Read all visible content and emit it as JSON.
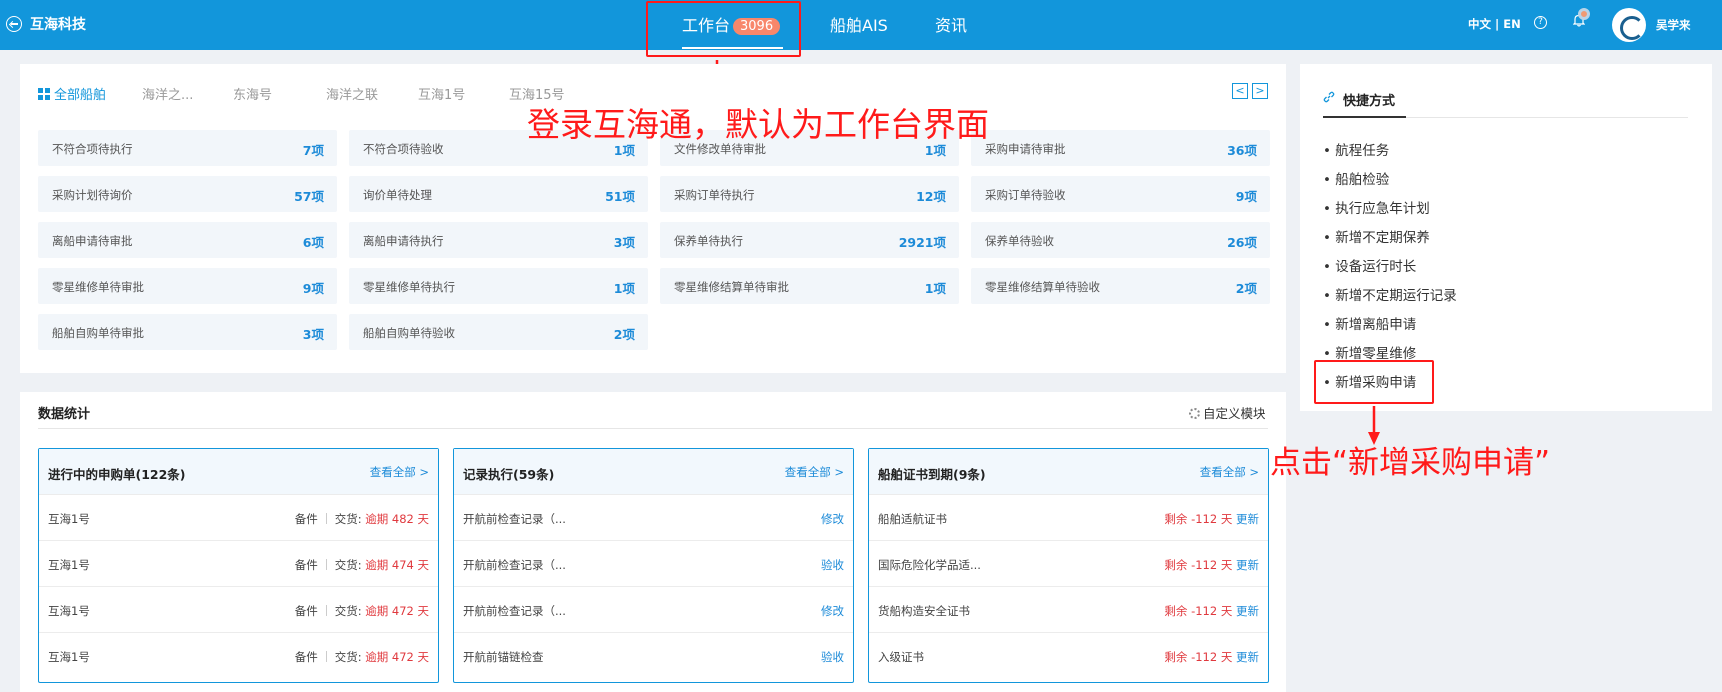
{
  "header": {
    "brand": "互海科技",
    "tabs": [
      {
        "label": "工作台",
        "badge": "3096"
      },
      {
        "label": "船舶AIS"
      },
      {
        "label": "资讯"
      }
    ],
    "language": "中文 | EN",
    "help_glyph": "?",
    "username": "吴学来"
  },
  "ship_tabs": [
    "全部船舶",
    "海洋之...",
    "东海号",
    "海洋之联",
    "互海1号",
    "互海15号"
  ],
  "pager": {
    "prev": "<",
    "next": ">"
  },
  "tasks": [
    {
      "label": "不符合项待执行",
      "value": "7项"
    },
    {
      "label": "不符合项待验收",
      "value": "1项"
    },
    {
      "label": "文件修改单待审批",
      "value": "1项"
    },
    {
      "label": "采购申请待审批",
      "value": "36项"
    },
    {
      "label": "采购计划待询价",
      "value": "57项"
    },
    {
      "label": "询价单待处理",
      "value": "51项"
    },
    {
      "label": "采购订单待执行",
      "value": "12项"
    },
    {
      "label": "采购订单待验收",
      "value": "9项"
    },
    {
      "label": "离船申请待审批",
      "value": "6项"
    },
    {
      "label": "离船申请待执行",
      "value": "3项"
    },
    {
      "label": "保养单待执行",
      "value": "2921项"
    },
    {
      "label": "保养单待验收",
      "value": "26项"
    },
    {
      "label": "零星维修单待审批",
      "value": "9项"
    },
    {
      "label": "零星维修单待执行",
      "value": "1项"
    },
    {
      "label": "零星维修结算单待审批",
      "value": "1项"
    },
    {
      "label": "零星维修结算单待验收",
      "value": "2项"
    },
    {
      "label": "船舶自购单待审批",
      "value": "3项"
    },
    {
      "label": "船舶自购单待验收",
      "value": "2项"
    }
  ],
  "annotations": {
    "login": "登录互海通，默认为工作台界面",
    "click": "点击“新增采购申请”"
  },
  "stats": {
    "title": "数据统计",
    "customize": "自定义模块",
    "cards": [
      {
        "title": "进行中的申购单(122条)",
        "more": "查看全部 >",
        "rows": [
          {
            "name": "互海1号",
            "type": "备件",
            "delivery_label": "交货:",
            "status": "逾期",
            "days": "482 天"
          },
          {
            "name": "互海1号",
            "type": "备件",
            "delivery_label": "交货:",
            "status": "逾期",
            "days": "474 天"
          },
          {
            "name": "互海1号",
            "type": "备件",
            "delivery_label": "交货:",
            "status": "逾期",
            "days": "472 天"
          },
          {
            "name": "互海1号",
            "type": "备件",
            "delivery_label": "交货:",
            "status": "逾期",
            "days": "472 天"
          }
        ]
      },
      {
        "title": "记录执行(59条)",
        "more": "查看全部 >",
        "rows": [
          {
            "name": "开航前检查记录（...",
            "action": "修改"
          },
          {
            "name": "开航前检查记录（...",
            "action": "验收"
          },
          {
            "name": "开航前检查记录（...",
            "action": "修改"
          },
          {
            "name": "开航前锚链检查",
            "action": "验收"
          }
        ]
      },
      {
        "title": "船舶证书到期(9条)",
        "more": "查看全部 >",
        "rows": [
          {
            "name": "船舶适航证书",
            "remain": "剩余 -112 天",
            "action": "更新"
          },
          {
            "name": "国际危险化学品适...",
            "remain": "剩余 -112 天",
            "action": "更新"
          },
          {
            "name": "货船构造安全证书",
            "remain": "剩余 -112 天",
            "action": "更新"
          },
          {
            "name": "入级证书",
            "remain": "剩余 -112 天",
            "action": "更新"
          }
        ]
      }
    ]
  },
  "quick": {
    "title": "快捷方式",
    "items": [
      "• 航程任务",
      "• 船舶检验",
      "• 执行应急年计划",
      "• 新增不定期保养",
      "• 设备运行时长",
      "• 新增不定期运行记录",
      "• 新增离船申请",
      "• 新增零星维修",
      "• 新增采购申请"
    ]
  }
}
